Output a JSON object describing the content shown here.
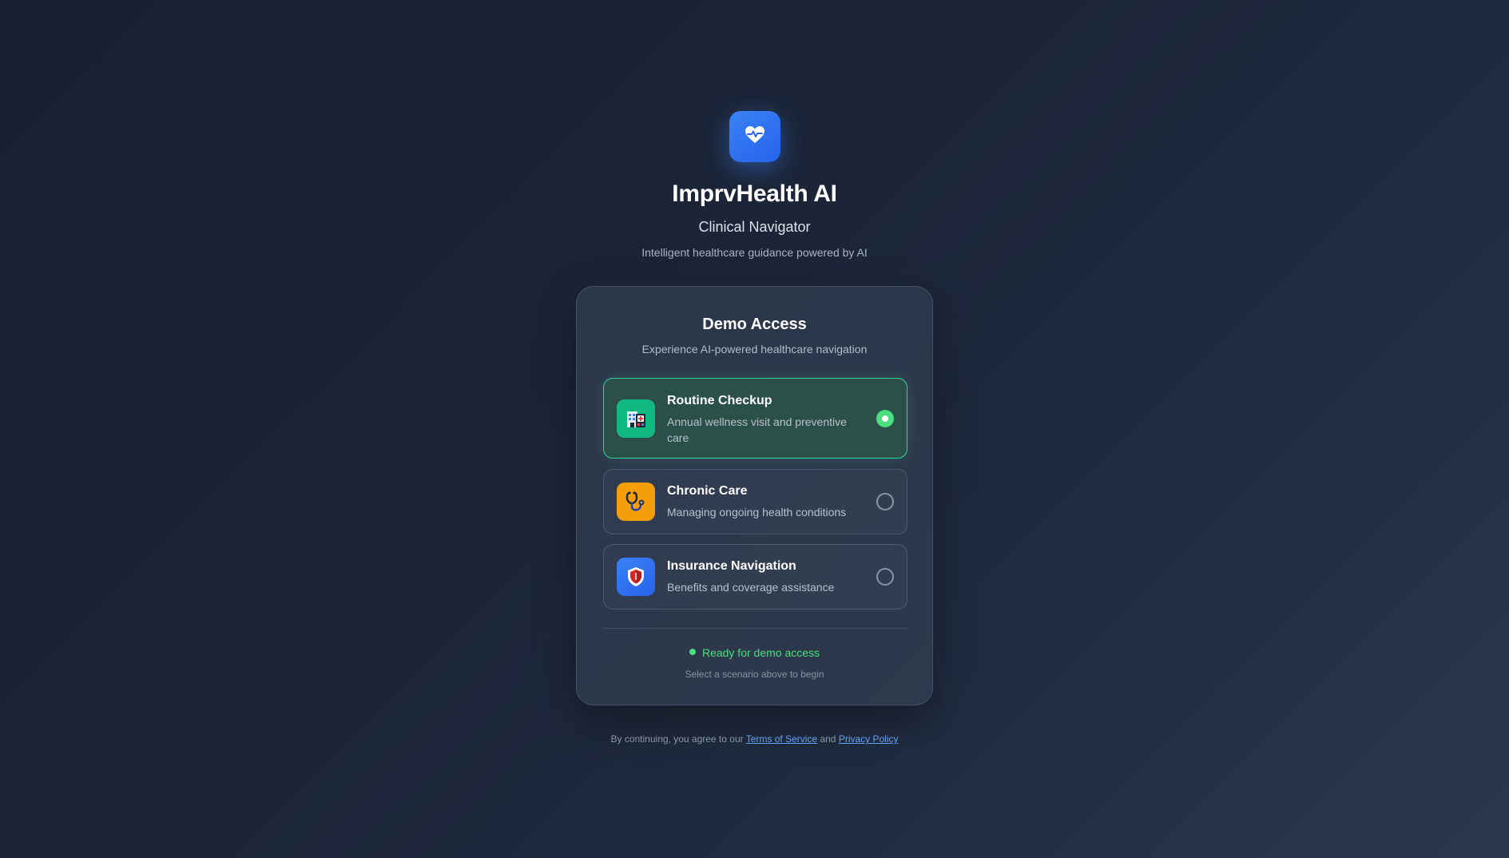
{
  "brand": {
    "icon": "heart-pulse-icon",
    "title": "ImprvHealth AI",
    "subtitle": "Clinical Navigator",
    "tagline": "Intelligent healthcare guidance powered by AI",
    "accent_color": "#3b82f6"
  },
  "card": {
    "title": "Demo Access",
    "description": "Experience AI-powered healthcare navigation",
    "options": [
      {
        "title": "Routine Checkup",
        "description": "Annual wellness visit and preventive care",
        "icon": "hospital-icon",
        "icon_bg": "#10b981",
        "selected": true
      },
      {
        "title": "Chronic Care",
        "description": "Managing ongoing health conditions",
        "icon": "stethoscope-icon",
        "icon_bg": "#f59e0b",
        "selected": false
      },
      {
        "title": "Insurance Navigation",
        "description": "Benefits and coverage assistance",
        "icon": "shield-icon",
        "icon_bg": "#3b82f6",
        "selected": false
      }
    ],
    "status": "Ready for demo access",
    "status_color": "#4ade80",
    "hint": "Select a scenario above to begin"
  },
  "legal": {
    "prefix": "By continuing, you agree to our",
    "terms": "Terms of Service",
    "conjunction": "and",
    "privacy": "Privacy Policy"
  }
}
